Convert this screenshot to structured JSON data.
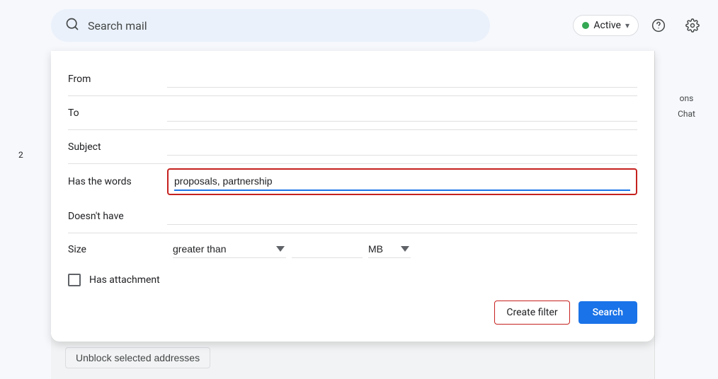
{
  "topbar": {
    "search_placeholder": "Search mail",
    "active_label": "Active",
    "help_icon": "help-circle-icon",
    "settings_icon": "gear-icon"
  },
  "sidebar": {
    "badge_number": "2",
    "chat_label": "Chat",
    "ons_label": "ons"
  },
  "filter_dialog": {
    "from_label": "From",
    "to_label": "To",
    "subject_label": "Subject",
    "has_words_label": "Has the words",
    "has_words_value": "proposals, partnership",
    "doesnt_have_label": "Doesn't have",
    "size_label": "Size",
    "size_comparator": "greater than",
    "size_unit": "MB",
    "has_attachment_label": "Has attachment",
    "create_filter_label": "Create filter",
    "search_label": "Search"
  },
  "bottom_bar": {
    "unblock_label": "Unblock selected addresses"
  }
}
